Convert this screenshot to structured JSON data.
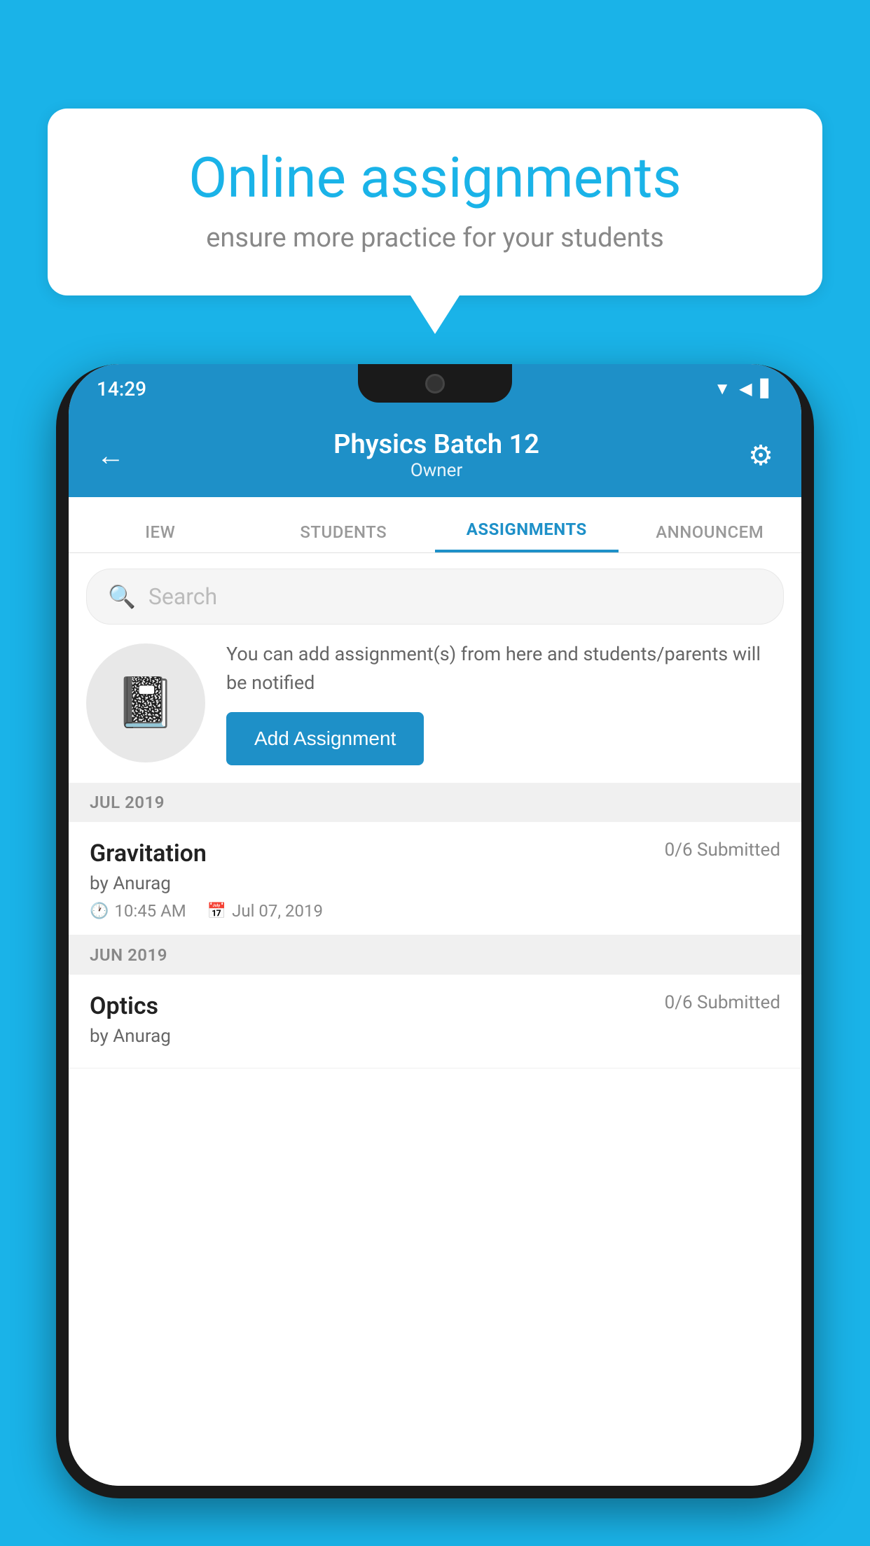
{
  "background": {
    "color": "#1ab3e8"
  },
  "speech_bubble": {
    "title": "Online assignments",
    "subtitle": "ensure more practice for your students"
  },
  "status_bar": {
    "time": "14:29",
    "icons": [
      "wifi",
      "signal",
      "battery"
    ]
  },
  "header": {
    "title": "Physics Batch 12",
    "subtitle": "Owner",
    "back_label": "←",
    "settings_label": "⚙"
  },
  "tabs": [
    {
      "label": "IEW",
      "active": false
    },
    {
      "label": "STUDENTS",
      "active": false
    },
    {
      "label": "ASSIGNMENTS",
      "active": true
    },
    {
      "label": "ANNOUNCEM",
      "active": false
    }
  ],
  "search": {
    "placeholder": "Search"
  },
  "promo": {
    "text": "You can add assignment(s) from here and students/parents will be notified",
    "button_label": "Add Assignment"
  },
  "sections": [
    {
      "label": "JUL 2019",
      "assignments": [
        {
          "name": "Gravitation",
          "submitted": "0/6 Submitted",
          "by": "by Anurag",
          "time": "10:45 AM",
          "date": "Jul 07, 2019"
        }
      ]
    },
    {
      "label": "JUN 2019",
      "assignments": [
        {
          "name": "Optics",
          "submitted": "0/6 Submitted",
          "by": "by Anurag",
          "time": "",
          "date": ""
        }
      ]
    }
  ]
}
